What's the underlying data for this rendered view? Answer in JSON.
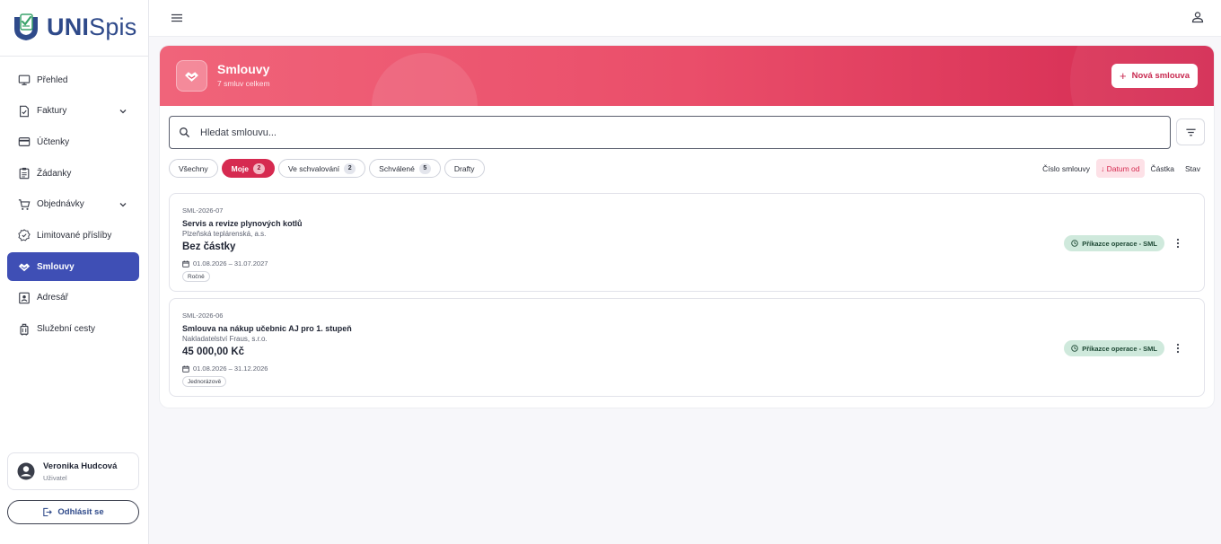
{
  "app": {
    "logo_strong": "UNI",
    "logo_light": "Spis",
    "brand_color": "#2f4a8a",
    "accent_color": "#d62a50"
  },
  "sidebar": {
    "items": [
      {
        "label": "Přehled",
        "icon": "monitor-icon",
        "expandable": false,
        "active": false
      },
      {
        "label": "Faktury",
        "icon": "invoice-icon",
        "expandable": true,
        "active": false
      },
      {
        "label": "Účtenky",
        "icon": "receipt-icon",
        "expandable": false,
        "active": false
      },
      {
        "label": "Žádanky",
        "icon": "clipboard-icon",
        "expandable": false,
        "active": false
      },
      {
        "label": "Objednávky",
        "icon": "cart-icon",
        "expandable": true,
        "active": false
      },
      {
        "label": "Limitované příslíby",
        "icon": "limit-badge-icon",
        "expandable": false,
        "active": false
      },
      {
        "label": "Smlouvy",
        "icon": "handshake-icon",
        "expandable": false,
        "active": true
      },
      {
        "label": "Adresář",
        "icon": "contacts-icon",
        "expandable": false,
        "active": false
      },
      {
        "label": "Služební cesty",
        "icon": "luggage-icon",
        "expandable": false,
        "active": false
      }
    ],
    "user": {
      "name": "Veronika Hudcová",
      "role": "Uživatel"
    },
    "logout_label": "Odhlásit se"
  },
  "header": {
    "title": "Smlouvy",
    "subtitle": "7 smluv celkem",
    "new_button": "Nová smlouva"
  },
  "search": {
    "placeholder": "Hledat smlouvu..."
  },
  "filters": [
    {
      "label": "Všechny",
      "count": null,
      "active": false
    },
    {
      "label": "Moje",
      "count": "2",
      "active": true
    },
    {
      "label": "Ve schvalování",
      "count": "2",
      "active": false
    },
    {
      "label": "Schválené",
      "count": "5",
      "active": false
    },
    {
      "label": "Drafty",
      "count": null,
      "active": false
    }
  ],
  "sort": {
    "options": [
      "Číslo smlouvy",
      "Datum od",
      "Částka",
      "Stav"
    ],
    "active": "Datum od",
    "direction": "desc"
  },
  "contracts": [
    {
      "number": "SML-2026-07",
      "title": "Servis a revize plynových kotlů",
      "organization": "Plzeňská teplárenská, a.s.",
      "amount": "Bez částky",
      "dates": "01.08.2026 – 31.07.2027",
      "period": "Ročně",
      "status": "Příkazce operace - SML"
    },
    {
      "number": "SML-2026-06",
      "title": "Smlouva na nákup učebnic AJ pro 1. stupeň",
      "organization": "Nakladatelství Fraus, s.r.o.",
      "amount": "45 000,00 Kč",
      "dates": "01.08.2026 – 31.12.2026",
      "period": "Jednorázově",
      "status": "Příkazce operace - SML"
    }
  ]
}
